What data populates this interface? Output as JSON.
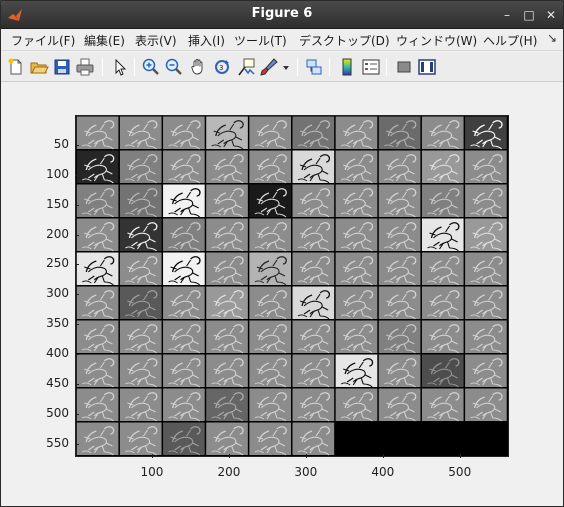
{
  "window": {
    "title": "Figure 6",
    "controls": {
      "minimize": "–",
      "maximize": "□",
      "close": "✕"
    }
  },
  "menu": {
    "items": [
      "ファイル(F)",
      "編集(E)",
      "表示(V)",
      "挿入(I)",
      "ツール(T)",
      "デスクトップ(D)",
      "ウィンドウ(W)",
      "ヘルプ(H)"
    ],
    "overflow_glyph": "↘"
  },
  "toolbar": {
    "buttons": [
      "new-figure-icon",
      "open-file-icon",
      "save-icon",
      "print-icon",
      "pointer-icon",
      "zoom-in-icon",
      "zoom-out-icon",
      "pan-hand-icon",
      "rotate-3d-icon",
      "data-cursor-icon",
      "brush-icon",
      "brush-dropdown-icon",
      "link-plot-icon",
      "colorbar-icon",
      "legend-icon",
      "hide-plot-tools-icon",
      "show-plot-tools-icon"
    ]
  },
  "axes": {
    "yticks": [
      "50",
      "100",
      "150",
      "200",
      "250",
      "300",
      "350",
      "400",
      "450",
      "500",
      "550"
    ],
    "xticks": [
      "100",
      "200",
      "300",
      "400",
      "500"
    ]
  },
  "montage": {
    "rows": 10,
    "cols": 10,
    "filled_tiles": 96,
    "background": "#000000",
    "tile_brightness": [
      [
        0.55,
        0.55,
        0.55,
        0.72,
        0.55,
        0.45,
        0.55,
        0.42,
        0.55,
        0.25
      ],
      [
        0.15,
        0.5,
        0.55,
        0.55,
        0.55,
        0.85,
        0.55,
        0.55,
        0.6,
        0.55
      ],
      [
        0.5,
        0.45,
        0.95,
        0.55,
        0.1,
        0.55,
        0.55,
        0.55,
        0.5,
        0.55
      ],
      [
        0.55,
        0.2,
        0.5,
        0.55,
        0.55,
        0.55,
        0.55,
        0.55,
        0.9,
        0.6
      ],
      [
        0.9,
        0.55,
        0.95,
        0.55,
        0.7,
        0.55,
        0.55,
        0.55,
        0.55,
        0.55
      ],
      [
        0.55,
        0.35,
        0.55,
        0.6,
        0.55,
        0.85,
        0.55,
        0.55,
        0.55,
        0.55
      ],
      [
        0.55,
        0.55,
        0.55,
        0.55,
        0.55,
        0.55,
        0.55,
        0.5,
        0.55,
        0.55
      ],
      [
        0.55,
        0.55,
        0.55,
        0.55,
        0.55,
        0.55,
        0.9,
        0.55,
        0.3,
        0.55
      ],
      [
        0.55,
        0.55,
        0.55,
        0.4,
        0.55,
        0.55,
        0.55,
        0.55,
        0.55,
        0.55
      ],
      [
        0.55,
        0.55,
        0.35,
        0.55,
        0.55,
        0.55,
        null,
        null,
        null,
        null
      ]
    ]
  }
}
